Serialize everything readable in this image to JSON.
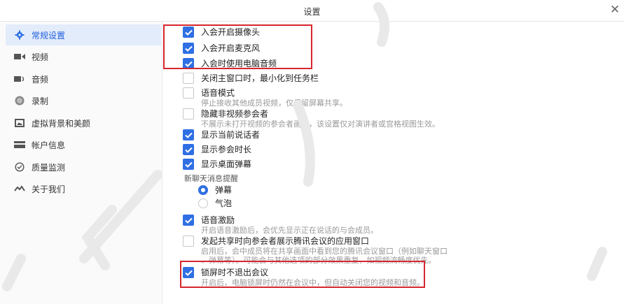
{
  "window": {
    "title": "设置",
    "close_glyph": "✕"
  },
  "sidebar": {
    "items": [
      {
        "label": "常规设置",
        "icon": "gear-icon",
        "active": true
      },
      {
        "label": "视频",
        "icon": "camera-icon"
      },
      {
        "label": "音频",
        "icon": "speaker-icon"
      },
      {
        "label": "录制",
        "icon": "record-icon"
      },
      {
        "label": "虚拟背景和美颜",
        "icon": "image-icon"
      },
      {
        "label": "帐户信息",
        "icon": "card-icon"
      },
      {
        "label": "质量监测",
        "icon": "monitor-icon"
      },
      {
        "label": "关于我们",
        "icon": "about-icon"
      }
    ]
  },
  "options": {
    "camera_on_join": {
      "label": "入会开启摄像头",
      "checked": true
    },
    "mic_on_join": {
      "label": "入会开启麦克风",
      "checked": true
    },
    "computer_audio": {
      "label": "入会时使用电脑音频",
      "checked": true
    },
    "minimize_to_tray": {
      "label": "关闭主窗口时，最小化到任务栏",
      "checked": false
    },
    "voice_mode": {
      "label": "语音模式",
      "desc": "停止接收其他成员视频，仅保留屏幕共享。",
      "checked": false
    },
    "hide_no_video": {
      "label": "隐藏非视频参会者",
      "desc": "不展示未打开视频的参会者画面，该设置仅对演讲者或宫格视图生效。",
      "checked": false
    },
    "show_speaker": {
      "label": "显示当前说话者",
      "checked": true
    },
    "show_duration": {
      "label": "显示参会时长",
      "checked": true
    },
    "show_danmaku": {
      "label": "显示桌面弹幕",
      "checked": true
    },
    "voice_motivation": {
      "label": "语音激励",
      "desc": "开启语音激励后，会优先显示正在说话的与会成员。",
      "checked": true
    },
    "share_app_window": {
      "label": "发起共享时向参会者展示腾讯会议的应用窗口",
      "desc1": "启用后，会中成员将在共享画面中看到您的腾讯会议窗口（例如聊天窗口",
      "desc2": "、弹幕等）。可能会与其他选项的部分效果重复，如视频流畅度优先。",
      "checked": false
    },
    "lock_screen": {
      "label": "锁屏时不退出会议",
      "desc": "开启后，电脑锁屏时仍然在会议中，但自动关闭您的视频和音频。",
      "checked": true
    }
  },
  "chat_reminder": {
    "label": "新聊天消息提醒",
    "choices": [
      {
        "label": "弹幕",
        "selected": true
      },
      {
        "label": "气泡",
        "selected": false
      }
    ]
  },
  "colors": {
    "accent": "#2f6fe3",
    "highlight": "#d6262d",
    "active_bg": "#e3ecfb"
  }
}
